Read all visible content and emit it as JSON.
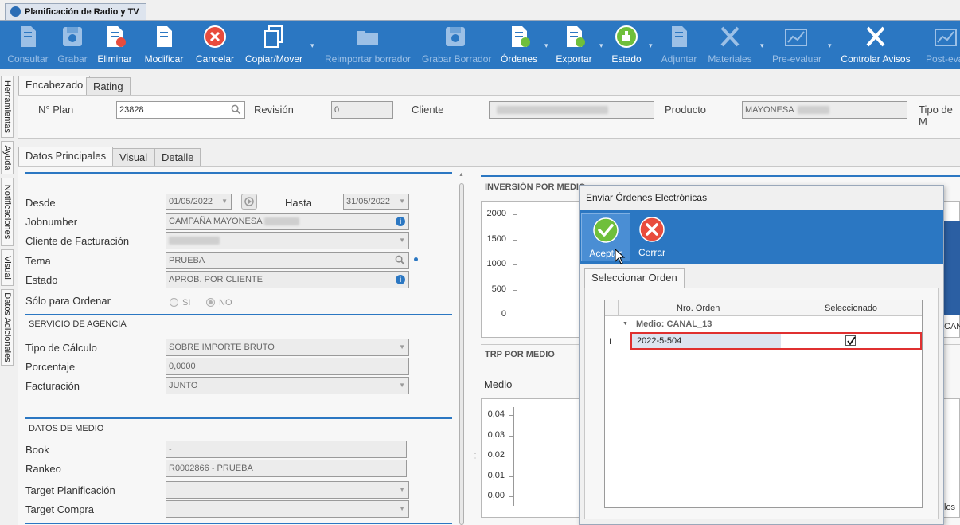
{
  "window": {
    "title": "Planificación de Radio y TV"
  },
  "toolbar": {
    "items": [
      {
        "label": "Consultar",
        "icon": "search-doc-icon",
        "enabled": false
      },
      {
        "label": "Grabar",
        "icon": "save-icon",
        "enabled": false
      },
      {
        "label": "Eliminar",
        "icon": "delete-doc-icon",
        "enabled": true
      },
      {
        "label": "Modificar",
        "icon": "edit-doc-icon",
        "enabled": true
      },
      {
        "label": "Cancelar",
        "icon": "cancel-icon",
        "enabled": true
      },
      {
        "label": "Copiar/Mover",
        "icon": "copy-icon",
        "enabled": true
      },
      {
        "label": "Reimportar borrador",
        "icon": "folder-icon",
        "enabled": false
      },
      {
        "label": "Grabar Borrador",
        "icon": "save-draft-icon",
        "enabled": false
      },
      {
        "label": "Órdenes",
        "icon": "orders-icon",
        "enabled": true
      },
      {
        "label": "Exportar",
        "icon": "export-icon",
        "enabled": true
      },
      {
        "label": "Estado",
        "icon": "thumbs-up-icon",
        "enabled": true
      },
      {
        "label": "Adjuntar",
        "icon": "attach-icon",
        "enabled": false
      },
      {
        "label": "Materiales",
        "icon": "tools-icon",
        "enabled": false
      },
      {
        "label": "Pre-evaluar",
        "icon": "chart-icon",
        "enabled": false
      },
      {
        "label": "Controlar Avisos",
        "icon": "tools-icon",
        "enabled": true
      },
      {
        "label": "Post-eval",
        "icon": "chart-icon",
        "enabled": false
      }
    ]
  },
  "side_tabs": [
    "Herramientas",
    "Ayuda",
    "Notificaciones",
    "Visual",
    "Datos Adicionales"
  ],
  "header": {
    "tabs": [
      "Encabezado",
      "Rating"
    ],
    "plan_label": "N° Plan",
    "plan_value": "23828",
    "revision_label": "Revisión",
    "revision_value": "0",
    "cliente_label": "Cliente",
    "producto_label": "Producto",
    "producto_value": "MAYONESA",
    "tipo_label": "Tipo de M"
  },
  "main_tabs": [
    "Datos Principales",
    "Visual",
    "Detalle"
  ],
  "form": {
    "desde_label": "Desde",
    "desde_value": "01/05/2022",
    "hasta_label": "Hasta",
    "hasta_value": "31/05/2022",
    "jobnumber_label": "Jobnumber",
    "jobnumber_value": "CAMPAÑA MAYONESA",
    "cliente_fact_label": "Cliente de Facturación",
    "tema_label": "Tema",
    "tema_value": "PRUEBA",
    "estado_label": "Estado",
    "estado_value": "APROB. POR CLIENTE",
    "solo_label": "Sólo para Ordenar",
    "si_label": "SI",
    "no_label": "NO",
    "servicio_title": "SERVICIO DE AGENCIA",
    "tipo_calc_label": "Tipo de Cálculo",
    "tipo_calc_value": "SOBRE IMPORTE BRUTO",
    "porcentaje_label": "Porcentaje",
    "porcentaje_value": "0,0000",
    "facturacion_label": "Facturación",
    "facturacion_value": "JUNTO",
    "medio_title": "DATOS DE MEDIO",
    "book_label": "Book",
    "book_value": "-",
    "rankeo_label": "Rankeo",
    "rankeo_value": "R0002866 - PRUEBA",
    "target_plan_label": "Target Planificación",
    "target_compra_label": "Target Compra"
  },
  "charts": {
    "inversion_title": "INVERSIÓN POR MEDIO",
    "inversion_ticks": [
      "2000",
      "1500",
      "1000",
      "500",
      "0"
    ],
    "inversion_side_text": "CAN",
    "trp_title": "TRP POR MEDIO",
    "trp_sub": "Medio",
    "trp_ticks": [
      "0,04",
      "0,03",
      "0,02",
      "0,01",
      "0,00"
    ],
    "trp_side_text": "los"
  },
  "dialog": {
    "title": "Enviar Órdenes Electrónicas",
    "accept_label": "Aceptar",
    "close_label": "Cerrar",
    "tab": "Seleccionar Orden",
    "col_orden": "Nro. Orden",
    "col_sel": "Seleccionado",
    "group": "Medio: CANAL_13",
    "row_marker": "I",
    "row_orden": "2022-5-504",
    "row_selected": true
  }
}
